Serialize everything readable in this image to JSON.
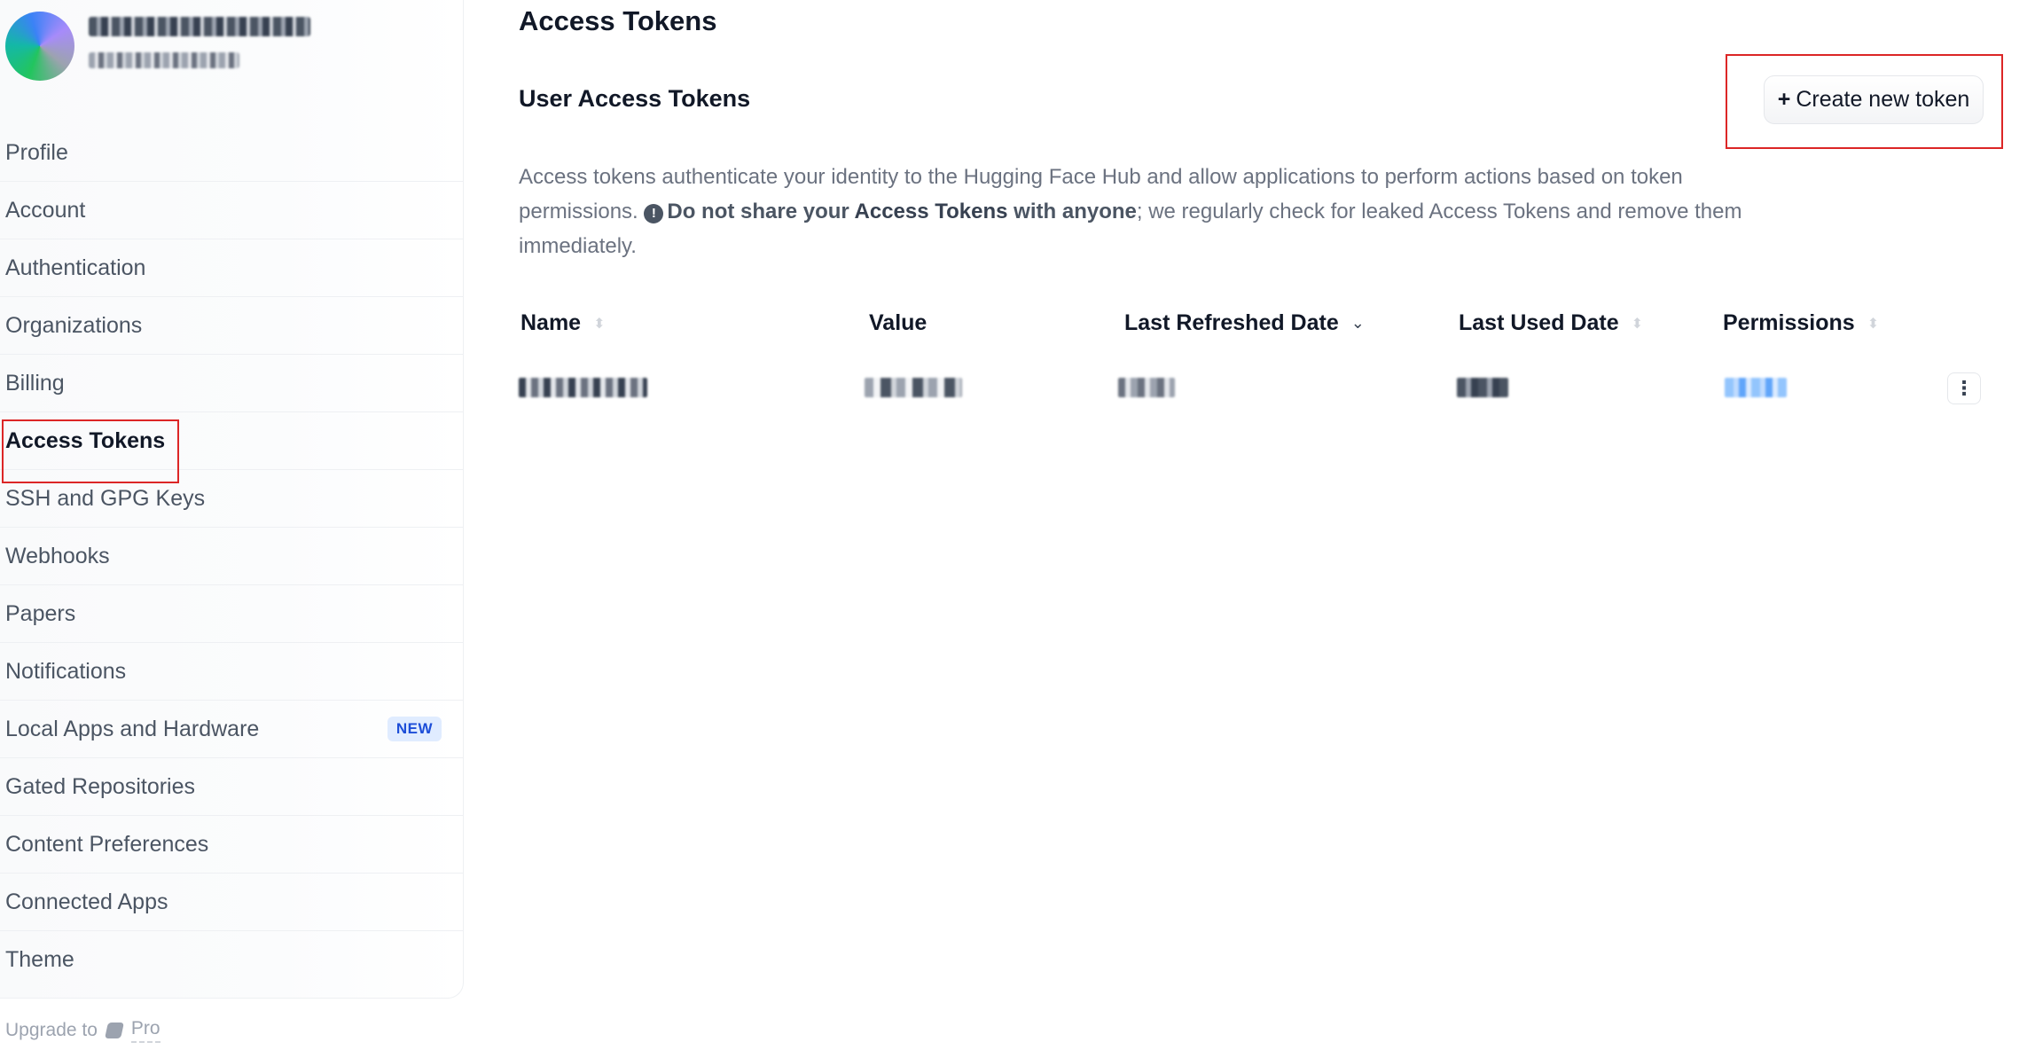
{
  "sidebar": {
    "items": [
      {
        "label": "Profile"
      },
      {
        "label": "Account"
      },
      {
        "label": "Authentication"
      },
      {
        "label": "Organizations"
      },
      {
        "label": "Billing"
      },
      {
        "label": "Access Tokens",
        "active": true
      },
      {
        "label": "SSH and GPG Keys"
      },
      {
        "label": "Webhooks"
      },
      {
        "label": "Papers"
      },
      {
        "label": "Notifications"
      },
      {
        "label": "Local Apps and Hardware",
        "badge": "NEW"
      },
      {
        "label": "Gated Repositories"
      },
      {
        "label": "Content Preferences"
      },
      {
        "label": "Connected Apps"
      },
      {
        "label": "Theme"
      }
    ],
    "upgrade_text": "Upgrade to",
    "upgrade_plan": "Pro"
  },
  "main": {
    "page_title": "Access Tokens",
    "section_title": "User Access Tokens",
    "create_button_label": "Create new token",
    "description": {
      "part1": "Access tokens authenticate your identity to the Hugging Face Hub and allow applications to perform actions based on token permissions.",
      "warning_prefix": "Do not share your ",
      "warning_strong": "Access Tokens",
      "warning_suffix": " with anyone",
      "part2": "; we regularly check for leaked Access Tokens and remove them immediately."
    },
    "table": {
      "columns": [
        "Name",
        "Value",
        "Last Refreshed Date",
        "Last Used Date",
        "Permissions"
      ]
    }
  },
  "colors": {
    "highlight": "#dc2626",
    "badge_bg": "#e0ecff",
    "badge_text": "#1d4ed8"
  },
  "icons": {
    "warning": "exclamation-circle-icon",
    "sort": "sort-icon",
    "menu": "kebab-icon",
    "pro": "pro-icon"
  }
}
